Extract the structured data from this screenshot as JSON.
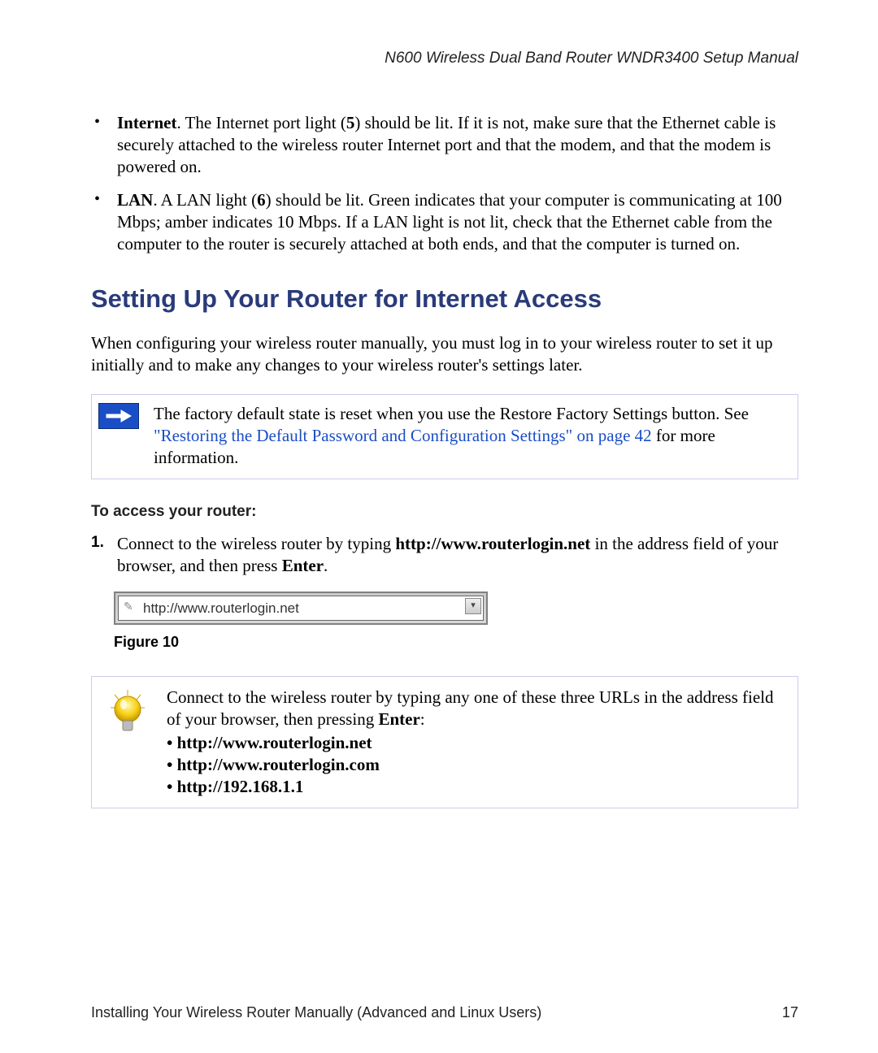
{
  "header": {
    "title": "N600 Wireless Dual Band Router WNDR3400 Setup Manual"
  },
  "bullets": {
    "item1": {
      "label": "Internet",
      "text": ". The Internet port light (",
      "num": "5",
      "rest": ") should be lit. If it is not, make sure that the Ethernet cable is securely attached to the wireless router Internet port and that the modem, and that the modem is powered on."
    },
    "item2": {
      "label": "LAN",
      "text": ". A LAN light (",
      "num": "6",
      "rest": ") should be lit. Green indicates that your computer is communicating at 100 Mbps; amber indicates 10 Mbps. If a LAN light is not lit, check that the Ethernet cable from the computer to the router is securely attached at both ends, and that the computer is turned on."
    }
  },
  "section": {
    "heading": "Setting Up Your Router for Internet Access"
  },
  "intro": "When configuring your wireless router manually, you must log in to your wireless router to set it up initially and to make any changes to your wireless router's settings later.",
  "note": {
    "pre": "The factory default state is reset when you use the Restore Factory Settings button. See ",
    "link": "\"Restoring the Default Password and Configuration Settings\" on page 42",
    "post": " for more information."
  },
  "access": {
    "subhead": "To access your router:",
    "step1": {
      "num": "1.",
      "pre": "Connect to the wireless router by typing ",
      "url": "http://www.routerlogin.net",
      "mid": " in the address field of your browser, and then press ",
      "enter": "Enter",
      "end": "."
    },
    "addrbar": "http://www.routerlogin.net",
    "figure": "Figure 10"
  },
  "tip": {
    "pre": "Connect to the wireless router by typing any one of these three URLs in the address field of your browser, then pressing ",
    "enter": "Enter",
    "colon": ":",
    "u1": "• http://www.routerlogin.net",
    "u2": "• http://www.routerlogin.com",
    "u3": "• http://192.168.1.1"
  },
  "footer": {
    "chapter": "Installing Your Wireless Router Manually (Advanced and Linux Users)",
    "page": "17"
  }
}
